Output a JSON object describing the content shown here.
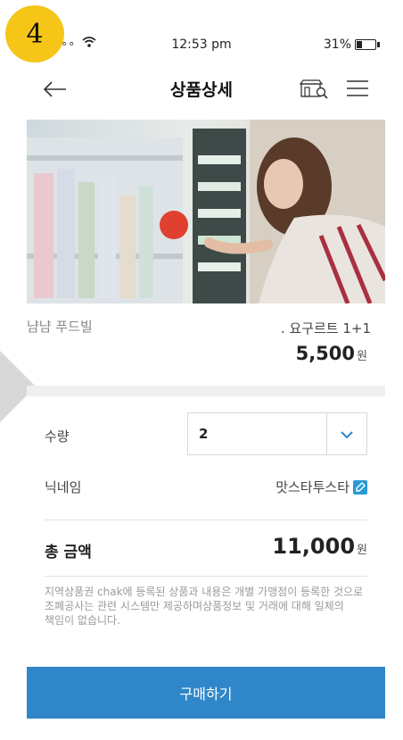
{
  "step_badge": "4",
  "status_bar": {
    "time": "12:53 pm",
    "battery": "31%",
    "battery_level": 0.31
  },
  "header": {
    "title": "상품상세"
  },
  "product": {
    "store_name": "냠냠 푸드빌",
    "name": ". 요구르트 1+1",
    "price": "5,500",
    "currency": "원"
  },
  "order": {
    "quantity_label": "수량",
    "quantity_value": "2",
    "nickname_label": "닉네임",
    "nickname_value": "맛스타투스타",
    "total_label": "총 금액",
    "total_value": "11,000",
    "currency": "원"
  },
  "notice": "지역상품권 chak에 등록된 상품과 내용은 개별 가맹점이 등록한 것으로 조폐공사는 관련 시스템만 제공하며상품정보 및 거래에 대해 일체의 책임이 없습니다.",
  "buy_button": "구매하기",
  "colors": {
    "accent": "#2f86c9",
    "badge": "#f5c518"
  }
}
